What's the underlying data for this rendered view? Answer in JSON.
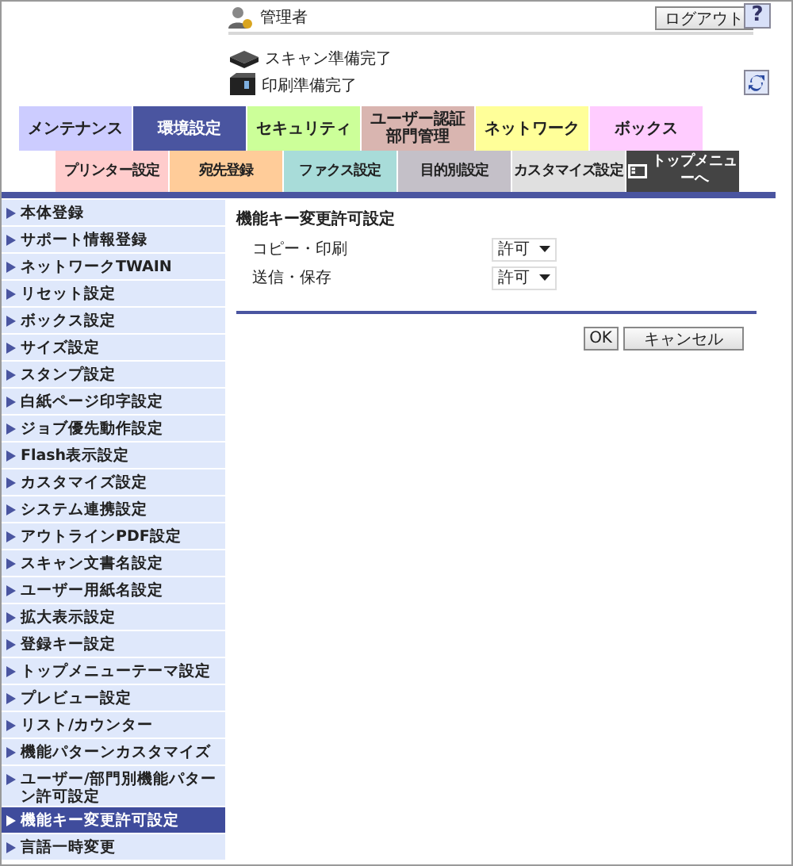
{
  "header": {
    "user": "管理者",
    "logout": "ログアウト",
    "help": "?",
    "status": [
      {
        "kind": "scanner",
        "text": "スキャン準備完了"
      },
      {
        "kind": "printer",
        "text": "印刷準備完了"
      }
    ]
  },
  "tabs": [
    {
      "label": "メンテナンス",
      "selected": false,
      "color": "#ccccff"
    },
    {
      "label": "環境設定",
      "selected": true,
      "color": "#4a55a0"
    },
    {
      "label": "セキュリティ",
      "selected": false,
      "color": "#ccff99"
    },
    {
      "label": "ユーザー認証部門管理",
      "selected": false,
      "color": "#d9b5b0"
    },
    {
      "label": "ネットワーク",
      "selected": false,
      "color": "#ffff99"
    },
    {
      "label": "ボックス",
      "selected": false,
      "color": "#ffccff"
    }
  ],
  "subtabs": [
    {
      "kind": "tab",
      "label": "プリンター設定",
      "color": "#ffcccc"
    },
    {
      "kind": "tab",
      "label": "宛先登録",
      "color": "#ffcc99"
    },
    {
      "kind": "tab",
      "label": "ファクス設定",
      "color": "#a8dcd9"
    },
    {
      "kind": "tab",
      "label": "目的別設定",
      "color": "#c4c0c8"
    },
    {
      "kind": "tab",
      "label": "カスタマイズ設定",
      "color": "#e0e0e0"
    },
    {
      "kind": "top-menu",
      "label": "トップメニューへ",
      "color": "#444444"
    }
  ],
  "sidebar": {
    "items": [
      {
        "label": "本体登録",
        "selected": false
      },
      {
        "label": "サポート情報登録",
        "selected": false
      },
      {
        "label": "ネットワークTWAIN",
        "selected": false
      },
      {
        "label": "リセット設定",
        "selected": false
      },
      {
        "label": "ボックス設定",
        "selected": false
      },
      {
        "label": "サイズ設定",
        "selected": false
      },
      {
        "label": "スタンプ設定",
        "selected": false
      },
      {
        "label": "白紙ページ印字設定",
        "selected": false
      },
      {
        "label": "ジョブ優先動作設定",
        "selected": false
      },
      {
        "label": "Flash表示設定",
        "selected": false
      },
      {
        "label": "カスタマイズ設定",
        "selected": false
      },
      {
        "label": "システム連携設定",
        "selected": false
      },
      {
        "label": "アウトラインPDF設定",
        "selected": false
      },
      {
        "label": "スキャン文書名設定",
        "selected": false
      },
      {
        "label": "ユーザー用紙名設定",
        "selected": false
      },
      {
        "label": "拡大表示設定",
        "selected": false
      },
      {
        "label": "登録キー設定",
        "selected": false
      },
      {
        "label": "トップメニューテーマ設定",
        "selected": false
      },
      {
        "label": "プレビュー設定",
        "selected": false
      },
      {
        "label": "リスト/カウンター",
        "selected": false
      },
      {
        "label": "機能パターンカスタマイズ",
        "selected": false
      },
      {
        "label": "ユーザー/部門別機能パターン許可設定",
        "selected": false
      },
      {
        "label": "機能キー変更許可設定",
        "selected": true
      },
      {
        "label": "言語一時変更",
        "selected": false
      }
    ]
  },
  "content": {
    "title": "機能キー変更許可設定",
    "rows": [
      {
        "label": "コピー・印刷",
        "value": "許可"
      },
      {
        "label": "送信・保存",
        "value": "許可"
      }
    ],
    "buttons": [
      "OK",
      "キャンセル"
    ]
  }
}
